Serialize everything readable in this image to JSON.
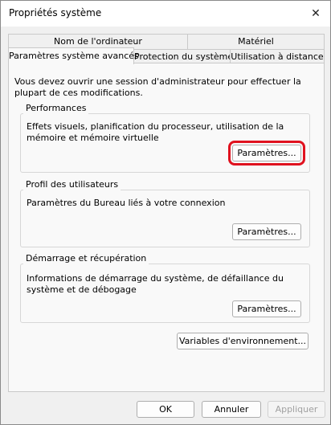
{
  "window": {
    "title": "Propriétés système",
    "close_glyph": "✕"
  },
  "tabs_row1": [
    {
      "label": "Nom de l'ordinateur"
    },
    {
      "label": "Matériel"
    }
  ],
  "tabs_row2": [
    {
      "label": "Paramètres système avancés",
      "active": true
    },
    {
      "label": "Protection du système"
    },
    {
      "label": "Utilisation à distance"
    }
  ],
  "intro": "Vous devez ouvrir une session d'administrateur pour effectuer la plupart de ces modifications.",
  "performances": {
    "label": "Performances",
    "description": "Effets visuels, planification du processeur, utilisation de la mémoire et mémoire virtuelle",
    "button": "Paramètres..."
  },
  "profil": {
    "label": "Profil des utilisateurs",
    "description": "Paramètres du Bureau liés à votre connexion",
    "button": "Paramètres..."
  },
  "demarrage": {
    "label": "Démarrage et récupération",
    "description": "Informations de démarrage du système, de défaillance du système et de débogage",
    "button": "Paramètres..."
  },
  "env_button": "Variables d'environnement...",
  "footer": {
    "ok": "OK",
    "cancel": "Annuler",
    "apply": "Appliquer"
  },
  "colors": {
    "highlight": "#e0121f"
  }
}
